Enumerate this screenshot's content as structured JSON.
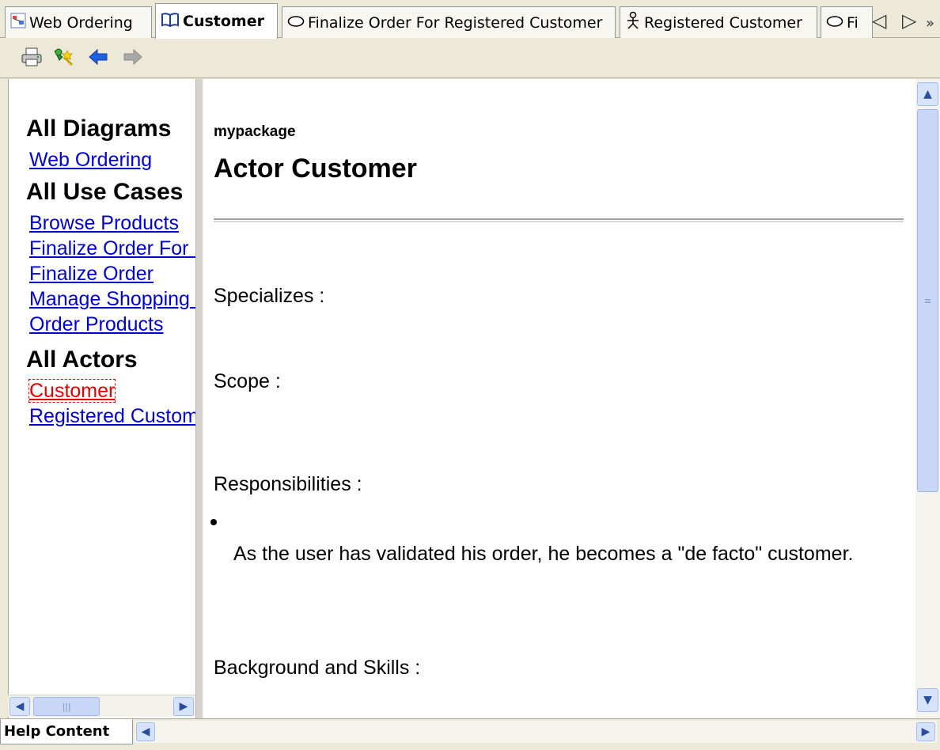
{
  "tabs": [
    {
      "label": "Web Ordering",
      "icon": "diagram-icon",
      "active": false
    },
    {
      "label": "Customer",
      "icon": "book-icon",
      "active": true
    },
    {
      "label": "Finalize Order For Registered Customer",
      "icon": "use-case-icon",
      "active": false
    },
    {
      "label": "Registered Customer",
      "icon": "actor-icon",
      "active": false
    },
    {
      "label": "Fi",
      "icon": "use-case-icon",
      "active": false
    }
  ],
  "tab_nav": {
    "prev": "◁",
    "next": "▷",
    "more": "»"
  },
  "toolbar": {
    "buttons": [
      {
        "name": "print",
        "icon": "printer-icon"
      },
      {
        "name": "find",
        "icon": "find-icon"
      },
      {
        "name": "back",
        "icon": "back-arrow-icon"
      },
      {
        "name": "forward",
        "icon": "forward-arrow-icon"
      }
    ]
  },
  "nav": {
    "all_diagrams": "All Diagrams",
    "diagrams": [
      "Web Ordering"
    ],
    "all_use_cases": "All Use Cases",
    "use_cases": [
      "Browse Products",
      "Finalize Order For Registered Customer",
      "Finalize Order",
      "Manage Shopping Cart",
      "Order Products"
    ],
    "all_actors": "All Actors",
    "actors": [
      "Customer",
      "Registered Customer"
    ],
    "current": "Customer"
  },
  "content": {
    "package": "mypackage",
    "title": "Actor Customer",
    "specializes": "Specializes :",
    "scope": "Scope :",
    "responsibilities": "Responsibilities :",
    "responsibility_items": [
      "As the user has validated his order, he becomes a \"de facto\" customer."
    ],
    "background": "Background and Skills :"
  },
  "bottom": {
    "tab_label": "Help Content"
  },
  "colors": {
    "link": "#0000cc",
    "current_link": "#e00000",
    "chrome": "#ece9d8",
    "scroll_button": "#d6e3fb"
  }
}
